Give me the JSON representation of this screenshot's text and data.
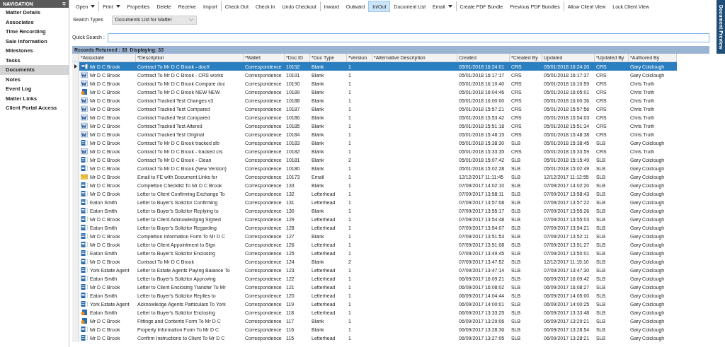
{
  "navigation": {
    "title": "NAVIGATION",
    "items": [
      {
        "label": "Matter Details",
        "selected": false
      },
      {
        "label": "Associates",
        "selected": false
      },
      {
        "label": "Time Recording",
        "selected": false
      },
      {
        "label": "Sale Information",
        "selected": false
      },
      {
        "label": "Milestones",
        "selected": false
      },
      {
        "label": "Tasks",
        "selected": false
      },
      {
        "label": "Documents",
        "selected": true
      },
      {
        "label": "Notes",
        "selected": false
      },
      {
        "label": "Event Log",
        "selected": false
      },
      {
        "label": "Matter Links",
        "selected": false
      },
      {
        "label": "Client Portal Access",
        "selected": false
      }
    ]
  },
  "toolbar": [
    [
      {
        "label": "Open",
        "dropdown": true,
        "selected": false
      }
    ],
    [
      {
        "label": "Print",
        "dropdown": true,
        "selected": false
      },
      {
        "label": "Properties",
        "dropdown": false,
        "selected": false
      },
      {
        "label": "Delete",
        "dropdown": false,
        "selected": false
      },
      {
        "label": "Receive",
        "dropdown": false,
        "selected": false
      },
      {
        "label": "Import",
        "dropdown": false,
        "selected": false
      }
    ],
    [
      {
        "label": "Check Out",
        "dropdown": false,
        "selected": false
      },
      {
        "label": "Check In",
        "dropdown": false,
        "selected": false
      },
      {
        "label": "Undo Checkout",
        "dropdown": false,
        "selected": false
      }
    ],
    [
      {
        "label": "Inward",
        "dropdown": false,
        "selected": false
      },
      {
        "label": "Outward",
        "dropdown": false,
        "selected": false
      },
      {
        "label": "In/Out",
        "dropdown": false,
        "selected": true
      },
      {
        "label": "Document List",
        "dropdown": false,
        "selected": false
      },
      {
        "label": "Email",
        "dropdown": true,
        "selected": false
      }
    ],
    [
      {
        "label": "Create PDF Bundle",
        "dropdown": false,
        "selected": false
      },
      {
        "label": "Previous PDF Bundles",
        "dropdown": false,
        "selected": false
      }
    ],
    [
      {
        "label": "Allow Client View",
        "dropdown": false,
        "selected": false
      },
      {
        "label": "Lock Client View",
        "dropdown": false,
        "selected": false
      }
    ]
  ],
  "search_types": {
    "label": "Search Types",
    "value": "Documents List for Matter"
  },
  "quick_search": {
    "label": "Quick Search :"
  },
  "records_bar": "Records Returned : 33  Displaying: 33",
  "side_tab": "Document Preview",
  "table": {
    "columns": [
      "*Associate",
      "*Description",
      "*Wallet",
      "*Doc ID",
      "*Doc Type",
      "*Version",
      "*Alternative Description",
      "Created",
      "*Created By",
      "Updated",
      "*Updated By",
      "*Authored By"
    ],
    "rows": [
      {
        "kind": "doc",
        "selected": true,
        "associate": "Mr D C Brook",
        "description": "Contract To Mr D C Brook - docX",
        "wallet": "Correspondence",
        "doc_id": "10192",
        "doc_type": "Blank",
        "version": "1",
        "created": "05/01/2018 16:24:01",
        "created_by": "CRS",
        "updated": "05/01/2018 16:24:20",
        "updated_by": "CRS",
        "authored_by": "Gary Colclough"
      },
      {
        "kind": "word",
        "selected": false,
        "associate": "Mr D C Brook",
        "description": "Contract To Mr D C Brook - CRS works",
        "wallet": "Correspondence",
        "doc_id": "10191",
        "doc_type": "Blank",
        "version": "1",
        "created": "05/01/2018 16:17:17",
        "created_by": "CRS",
        "updated": "05/01/2018 16:17:37",
        "updated_by": "CRS",
        "authored_by": "Gary Colclough"
      },
      {
        "kind": "word",
        "selected": false,
        "associate": "Mr D C Brook",
        "description": "Contract To Mr D C Brook Compare doc",
        "wallet": "Correspondence",
        "doc_id": "10190",
        "doc_type": "Blank",
        "version": "1",
        "created": "05/01/2018 16:10:40",
        "created_by": "CRS",
        "updated": "05/01/2018 16:10:59",
        "updated_by": "CRS",
        "authored_by": "Chris Troth"
      },
      {
        "kind": "badge",
        "selected": false,
        "associate": "Mr D C Brook",
        "description": "Contract To Mr D C Brook NEW NEW",
        "wallet": "Correspondence",
        "doc_id": "10189",
        "doc_type": "Blank",
        "version": "1",
        "created": "05/01/2018 16:04:46",
        "created_by": "CRS",
        "updated": "05/01/2018 16:05:01",
        "updated_by": "CRS",
        "authored_by": "Chris Troth"
      },
      {
        "kind": "word",
        "selected": false,
        "associate": "Mr D C Brook",
        "description": "Contract Tracked Test Changes v3",
        "wallet": "Correspondence",
        "doc_id": "10188",
        "doc_type": "Blank",
        "version": "1",
        "created": "05/01/2018 16:00:00",
        "created_by": "CRS",
        "updated": "05/01/2018 16:00:36",
        "updated_by": "CRS",
        "authored_by": "Chris Troth"
      },
      {
        "kind": "word",
        "selected": false,
        "associate": "Mr D C Brook",
        "description": "Contract Tracked Test Compared",
        "wallet": "Correspondence",
        "doc_id": "10187",
        "doc_type": "Blank",
        "version": "1",
        "created": "05/01/2018 15:57:21",
        "created_by": "CRS",
        "updated": "05/01/2018 15:57:56",
        "updated_by": "CRS",
        "authored_by": "Chris Troth"
      },
      {
        "kind": "word",
        "selected": false,
        "associate": "Mr D C Brook",
        "description": "Contract Tracked Test Compared",
        "wallet": "Correspondence",
        "doc_id": "10186",
        "doc_type": "Blank",
        "version": "1",
        "created": "05/01/2018 15:53:42",
        "created_by": "CRS",
        "updated": "05/01/2018 15:54:03",
        "updated_by": "CRS",
        "authored_by": "Chris Troth"
      },
      {
        "kind": "word",
        "selected": false,
        "associate": "Mr D C Brook",
        "description": "Contract Tracked Test Altered",
        "wallet": "Correspondence",
        "doc_id": "10185",
        "doc_type": "Blank",
        "version": "1",
        "created": "05/01/2018 15:51:18",
        "created_by": "CRS",
        "updated": "05/01/2018 15:51:34",
        "updated_by": "CRS",
        "authored_by": "Chris Troth"
      },
      {
        "kind": "word",
        "selected": false,
        "associate": "Mr D C Brook",
        "description": "Contract Tracked Test Original",
        "wallet": "Correspondence",
        "doc_id": "10184",
        "doc_type": "Blank",
        "version": "1",
        "created": "05/01/2018 15:48:15",
        "created_by": "CRS",
        "updated": "05/01/2018 15:48:38",
        "updated_by": "CRS",
        "authored_by": "Chris Troth"
      },
      {
        "kind": "doc",
        "selected": false,
        "associate": "Mr D C Brook",
        "description": "Contract To Mr D C Brook tracked slb",
        "wallet": "Correspondence",
        "doc_id": "10183",
        "doc_type": "Blank",
        "version": "1",
        "created": "05/01/2018 15:38:30",
        "created_by": "SLB",
        "updated": "05/01/2018 15:38:45",
        "updated_by": "SLB",
        "authored_by": "Gary Colclough"
      },
      {
        "kind": "word",
        "selected": false,
        "associate": "Mr D C Brook",
        "description": "Contract To Mr D C Brook - tracked crs",
        "wallet": "Correspondence",
        "doc_id": "10182",
        "doc_type": "Blank",
        "version": "1",
        "created": "05/01/2018 15:33:35",
        "created_by": "CRS",
        "updated": "05/01/2018 15:33:59",
        "updated_by": "CRS",
        "authored_by": "Chris Troth"
      },
      {
        "kind": "doc",
        "selected": false,
        "associate": "Mr D C Brook",
        "description": "Contract To Mr D C Brook - Clean",
        "wallet": "Correspondence",
        "doc_id": "10181",
        "doc_type": "Blank",
        "version": "2",
        "created": "05/01/2018 15:07:42",
        "created_by": "SLB",
        "updated": "05/01/2018 15:15:49",
        "updated_by": "SLB",
        "authored_by": "Gary Colclough"
      },
      {
        "kind": "doc",
        "selected": false,
        "associate": "Mr D C Brook",
        "description": "Contract To Mr D C Brook (New Version)",
        "wallet": "Correspondence",
        "doc_id": "10180",
        "doc_type": "Blank",
        "version": "1",
        "created": "05/01/2018 15:02:28",
        "created_by": "SLB",
        "updated": "05/01/2018 15:02:49",
        "updated_by": "SLB",
        "authored_by": "Gary Colclough"
      },
      {
        "kind": "email",
        "selected": false,
        "associate": "Mr D C Brook",
        "description": "Email to FE with Document Links for",
        "wallet": "Correspondence",
        "doc_id": "10173",
        "doc_type": "Email",
        "version": "1",
        "created": "12/12/2017 11:11:45",
        "created_by": "SLB",
        "updated": "12/12/2017 11:12:55",
        "updated_by": "SLB",
        "authored_by": "Gary Colclough"
      },
      {
        "kind": "doc",
        "selected": false,
        "associate": "Mr D C Brook",
        "description": "Completion Checklist To Mr D C Brook",
        "wallet": "Correspondence",
        "doc_id": "133",
        "doc_type": "Blank",
        "version": "1",
        "created": "07/09/2017 14:02:10",
        "created_by": "SLB",
        "updated": "07/09/2017 14:02:20",
        "updated_by": "SLB",
        "authored_by": "Gary Colclough"
      },
      {
        "kind": "doc",
        "selected": false,
        "associate": "Mr D C Brook",
        "description": "Letter to Client Confirming Exchange To",
        "wallet": "Correspondence",
        "doc_id": "132",
        "doc_type": "Letterhead",
        "version": "1",
        "created": "07/09/2017 13:58:11",
        "created_by": "SLB",
        "updated": "07/09/2017 13:58:43",
        "updated_by": "SLB",
        "authored_by": "Gary Colclough"
      },
      {
        "kind": "doc",
        "selected": false,
        "associate": "Eaton Smith",
        "description": "Letter to Buyer's Solicitor Confirming",
        "wallet": "Correspondence",
        "doc_id": "131",
        "doc_type": "Letterhead",
        "version": "1",
        "created": "07/09/2017 13:57:08",
        "created_by": "SLB",
        "updated": "07/09/2017 13:57:22",
        "updated_by": "SLB",
        "authored_by": "Gary Colclough"
      },
      {
        "kind": "doc",
        "selected": false,
        "associate": "Eaton Smith",
        "description": "Letter to Buyer's Solicitor Replying to",
        "wallet": "Correspondence",
        "doc_id": "130",
        "doc_type": "Blank",
        "version": "1",
        "created": "07/09/2017 13:55:17",
        "created_by": "SLB",
        "updated": "07/09/2017 13:55:26",
        "updated_by": "SLB",
        "authored_by": "Gary Colclough"
      },
      {
        "kind": "doc",
        "selected": false,
        "associate": "Mr D C Brook",
        "description": "Letter to Client Acknowledging Signed",
        "wallet": "Correspondence",
        "doc_id": "129",
        "doc_type": "Letterhead",
        "version": "1",
        "created": "07/09/2017 13:54:48",
        "created_by": "SLB",
        "updated": "07/09/2017 13:55:03",
        "updated_by": "SLB",
        "authored_by": "Gary Colclough"
      },
      {
        "kind": "doc",
        "selected": false,
        "associate": "Eaton Smith",
        "description": "Letter to Buyer's Solicitor Regarding",
        "wallet": "Correspondence",
        "doc_id": "128",
        "doc_type": "Letterhead",
        "version": "1",
        "created": "07/09/2017 13:54:07",
        "created_by": "SLB",
        "updated": "07/09/2017 13:54:21",
        "updated_by": "SLB",
        "authored_by": "Gary Colclough"
      },
      {
        "kind": "doc",
        "selected": false,
        "associate": "Mr D C Brook",
        "description": "Completion Information Form To Mr D C",
        "wallet": "Correspondence",
        "doc_id": "127",
        "doc_type": "Blank",
        "version": "1",
        "created": "07/09/2017 13:51:53",
        "created_by": "SLB",
        "updated": "07/09/2017 13:52:11",
        "updated_by": "SLB",
        "authored_by": "Gary Colclough"
      },
      {
        "kind": "doc",
        "selected": false,
        "associate": "Mr D C Brook",
        "description": "Letter to Client Appointment to Sign",
        "wallet": "Correspondence",
        "doc_id": "126",
        "doc_type": "Letterhead",
        "version": "1",
        "created": "07/09/2017 13:51:08",
        "created_by": "SLB",
        "updated": "07/09/2017 13:51:27",
        "updated_by": "SLB",
        "authored_by": "Gary Colclough"
      },
      {
        "kind": "doc",
        "selected": false,
        "associate": "Eaton Smith",
        "description": "Letter to Buyer's Solicitor Enclosing",
        "wallet": "Correspondence",
        "doc_id": "125",
        "doc_type": "Letterhead",
        "version": "1",
        "created": "07/09/2017 13:49:45",
        "created_by": "SLB",
        "updated": "07/09/2017 13:50:01",
        "updated_by": "SLB",
        "authored_by": "Gary Colclough"
      },
      {
        "kind": "doc",
        "selected": false,
        "associate": "Mr D C Brook",
        "description": "Contract To Mr D C Brook",
        "wallet": "Correspondence",
        "doc_id": "124",
        "doc_type": "Blank",
        "version": "2",
        "created": "07/09/2017 13:47:52",
        "created_by": "SLB",
        "updated": "12/12/2017 11:15:10",
        "updated_by": "SLB",
        "authored_by": "Gary Colclough"
      },
      {
        "kind": "doc",
        "selected": false,
        "associate": "York Estate Agent",
        "description": "Letter to Estate Agents Paying Balance To",
        "wallet": "Correspondence",
        "doc_id": "123",
        "doc_type": "Letterhead",
        "version": "1",
        "created": "07/09/2017 13:47:14",
        "created_by": "SLB",
        "updated": "07/09/2017 13:47:30",
        "updated_by": "SLB",
        "authored_by": "Gary Colclough"
      },
      {
        "kind": "doc",
        "selected": false,
        "associate": "Eaton Smith",
        "description": "Letter to Buyer's Solicitor Approving",
        "wallet": "Correspondence",
        "doc_id": "122",
        "doc_type": "Letterhead",
        "version": "1",
        "created": "06/09/2017 16:09:21",
        "created_by": "SLB",
        "updated": "06/09/2017 16:09:42",
        "updated_by": "SLB",
        "authored_by": "Gary Colclough"
      },
      {
        "kind": "doc",
        "selected": false,
        "associate": "Mr D C Brook",
        "description": "Letter to Client Enclosing Transfer To Mr",
        "wallet": "Correspondence",
        "doc_id": "121",
        "doc_type": "Letterhead",
        "version": "1",
        "created": "06/09/2017 16:08:02",
        "created_by": "SLB",
        "updated": "06/09/2017 16:08:27",
        "updated_by": "SLB",
        "authored_by": "Gary Colclough"
      },
      {
        "kind": "doc",
        "selected": false,
        "associate": "Eaton Smith",
        "description": "Letter to Buyer's Solicitor Replies to",
        "wallet": "Correspondence",
        "doc_id": "120",
        "doc_type": "Letterhead",
        "version": "1",
        "created": "06/09/2017 14:04:44",
        "created_by": "SLB",
        "updated": "06/09/2017 14:05:00",
        "updated_by": "SLB",
        "authored_by": "Gary Colclough"
      },
      {
        "kind": "doc",
        "selected": false,
        "associate": "York Estate Agent",
        "description": "Acknowledge Agents Particulars To York",
        "wallet": "Correspondence",
        "doc_id": "119",
        "doc_type": "Letterhead",
        "version": "1",
        "created": "06/09/2017 14:00:01",
        "created_by": "SLB",
        "updated": "06/09/2017 14:00:25",
        "updated_by": "SLB",
        "authored_by": "Gary Colclough"
      },
      {
        "kind": "badge",
        "selected": false,
        "associate": "Eaton Smith",
        "description": "Letter to Buyer's Solicitor Enclosing",
        "wallet": "Correspondence",
        "doc_id": "118",
        "doc_type": "Letterhead",
        "version": "1",
        "created": "06/09/2017 13:33:25",
        "created_by": "SLB",
        "updated": "06/09/2017 13:33:48",
        "updated_by": "SLB",
        "authored_by": "Gary Colclough"
      },
      {
        "kind": "badge",
        "selected": false,
        "associate": "Mr D C Brook",
        "description": "Fittings and Contents Form To Mr D C",
        "wallet": "Correspondence",
        "doc_id": "117",
        "doc_type": "Blank",
        "version": "1",
        "created": "06/09/2017 13:29:06",
        "created_by": "SLB",
        "updated": "06/09/2017 13:29:21",
        "updated_by": "SLB",
        "authored_by": "Gary Colclough"
      },
      {
        "kind": "doc",
        "selected": false,
        "associate": "Mr D C Brook",
        "description": "Property Information Form To Mr D C",
        "wallet": "Correspondence",
        "doc_id": "116",
        "doc_type": "Blank",
        "version": "1",
        "created": "06/09/2017 13:28:36",
        "created_by": "SLB",
        "updated": "06/09/2017 13:28:54",
        "updated_by": "SLB",
        "authored_by": "Gary Colclough"
      },
      {
        "kind": "doc",
        "selected": false,
        "associate": "Mr D C Brook",
        "description": "Confirm Instructions to Client To Mr D C",
        "wallet": "Correspondence",
        "doc_id": "115",
        "doc_type": "Letterhead",
        "version": "1",
        "created": "06/09/2017 13:27:05",
        "created_by": "SLB",
        "updated": "06/09/2017 13:28:21",
        "updated_by": "SLB",
        "authored_by": "Gary Colclough"
      }
    ]
  }
}
